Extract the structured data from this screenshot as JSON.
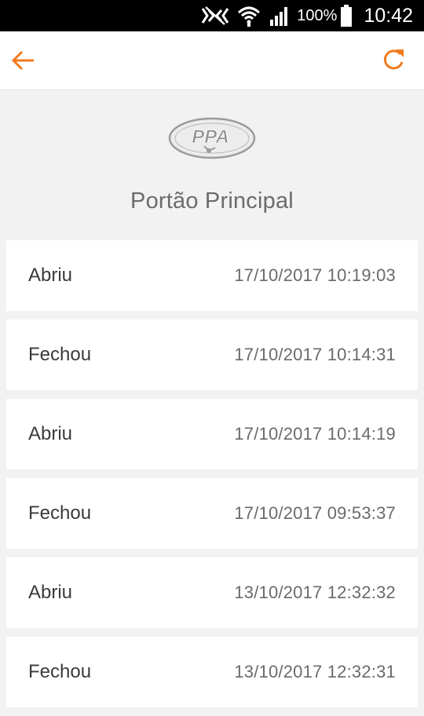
{
  "status_bar": {
    "battery_percent": "100%",
    "clock": "10:42",
    "icons": [
      "nfc-icon",
      "wifi-icon",
      "signal-icon",
      "battery-icon"
    ]
  },
  "app_bar": {
    "back_icon": "arrow-left-icon",
    "refresh_icon": "refresh-icon",
    "accent_color": "#f07a1e"
  },
  "logo": {
    "text": "PPA"
  },
  "page": {
    "title": "Portão Principal"
  },
  "events": [
    {
      "action": "Abriu",
      "datetime": "17/10/2017 10:19:03"
    },
    {
      "action": "Fechou",
      "datetime": "17/10/2017 10:14:31"
    },
    {
      "action": "Abriu",
      "datetime": "17/10/2017 10:14:19"
    },
    {
      "action": "Fechou",
      "datetime": "17/10/2017 09:53:37"
    },
    {
      "action": "Abriu",
      "datetime": "13/10/2017 12:32:32"
    },
    {
      "action": "Fechou",
      "datetime": "13/10/2017 12:32:31"
    }
  ]
}
